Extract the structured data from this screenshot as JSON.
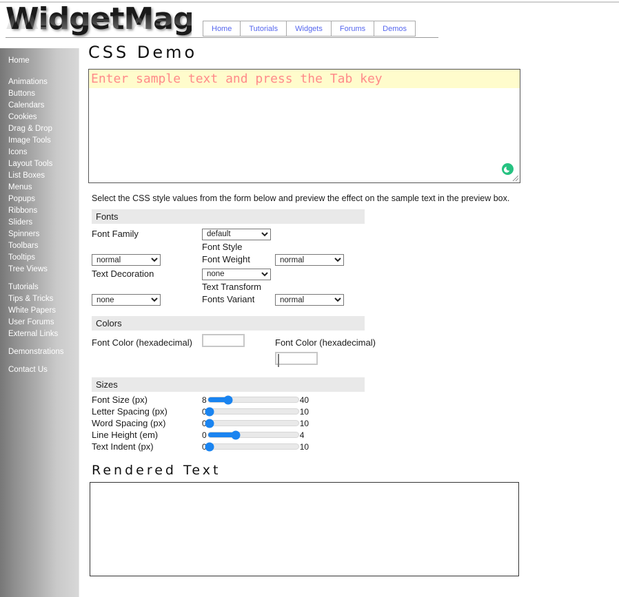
{
  "site": {
    "logo_text": "WidgetMage",
    "nav": [
      {
        "label": "Home"
      },
      {
        "label": "Tutorials"
      },
      {
        "label": "Widgets"
      },
      {
        "label": "Forums"
      },
      {
        "label": "Demos"
      }
    ]
  },
  "sidebar": {
    "top_item": "Home",
    "group_widgets": [
      "Animations",
      "Buttons",
      "Calendars",
      "Cookies",
      "Drag & Drop",
      "Image Tools",
      "Icons",
      "Layout Tools",
      "List Boxes",
      "Menus",
      "Popups",
      "Ribbons",
      "Sliders",
      "Spinners",
      "Toolbars",
      "Tooltips",
      "Tree Views"
    ],
    "group_resources": [
      "Tutorials",
      "Tips & Tricks",
      "White Papers",
      "User Forums",
      "External Links"
    ],
    "group_demos": [
      "Demonstrations"
    ],
    "group_contact": [
      "Contact Us"
    ]
  },
  "main": {
    "page_title": "CSS Demo",
    "sample_textarea": {
      "value": "",
      "placeholder": "Enter sample text and press the Tab key",
      "status_icon": "loading-spinner-icon"
    },
    "helper_text": "Select the CSS style values from the form below and preview the effect on the sample text in the preview box.",
    "rendered_title": "Rendered Text",
    "rendered_value": ""
  },
  "form": {
    "fonts": {
      "legend": "Fonts",
      "rows": [
        {
          "label_left": "Font Family",
          "select_left": "default",
          "label_mid": "",
          "select_right": ""
        },
        {
          "label_left": "",
          "select_left": "",
          "label_mid": "Font Style",
          "select_right": ""
        },
        {
          "label_left": "",
          "select_left": "normal",
          "label_mid": "Font Weight",
          "select_right": "normal"
        },
        {
          "label_left": "Text Decoration",
          "select_left": "none",
          "label_mid": "",
          "select_right": ""
        },
        {
          "label_left": "",
          "select_left": "",
          "label_mid": "Text Transform",
          "select_right": ""
        },
        {
          "label_left": "",
          "select_left": "none",
          "label_mid": "Fonts Variant",
          "select_right": "normal"
        }
      ],
      "options": {
        "font_family": [
          "default"
        ],
        "font_style": [
          "normal"
        ],
        "font_weight": [
          "normal"
        ],
        "text_decoration": [
          "none"
        ],
        "text_transform": [
          "none"
        ],
        "font_variant": [
          "normal"
        ]
      }
    },
    "colors": {
      "legend": "Colors",
      "label_left": "Font Color (hexadecimal)",
      "label_right": "Font Color (hexadecimal)",
      "swatch_value": "#000000",
      "text_value": ""
    },
    "sizes": {
      "legend": "Sizes",
      "sliders": [
        {
          "label": "Font Size (px)",
          "min": "8",
          "max": "40",
          "value": 15,
          "percent": 22
        },
        {
          "label": "Letter Spacing (px)",
          "min": "0",
          "max": "10",
          "value": 0,
          "percent": 2
        },
        {
          "label": "Word Spacing (px)",
          "min": "0",
          "max": "10",
          "value": 0,
          "percent": 2
        },
        {
          "label": "Line Height (em)",
          "min": "0",
          "max": "4",
          "value": 1.2,
          "percent": 31
        },
        {
          "label": "Text Indent (px)",
          "min": "0",
          "max": "10",
          "value": 0,
          "percent": 2
        }
      ]
    }
  },
  "colors_theme": {
    "nav_link": "#5566ee",
    "slider_accent": "#1a84f0",
    "placeholder_text": "#ff8a8a",
    "highlight_bg": "#fffccc",
    "section_head_bg": "#e9e9e9",
    "spinner_green": "#26c281"
  }
}
